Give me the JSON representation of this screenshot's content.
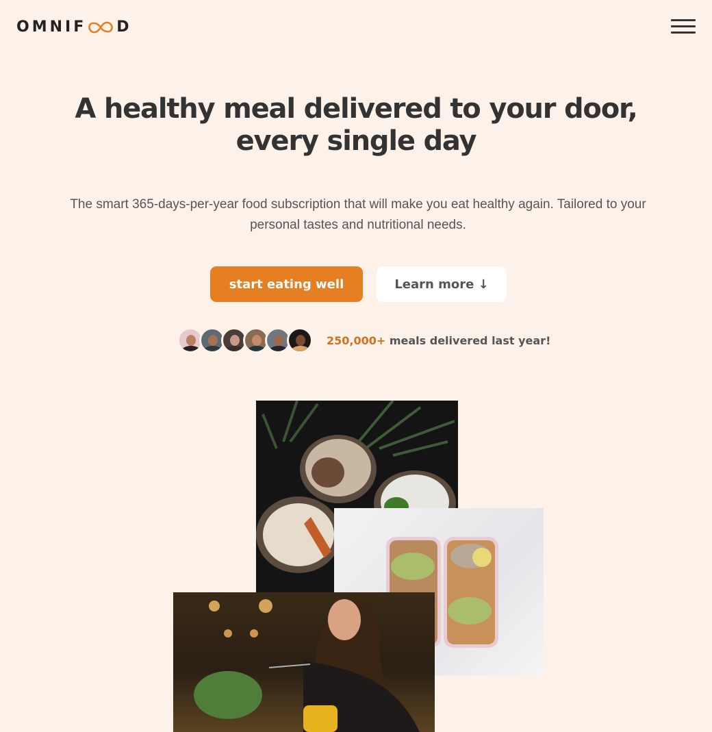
{
  "header": {
    "logo_text_before": "OMNIF",
    "logo_text_after": "D",
    "logo_infinity_icon": "infinity-icon",
    "accent_color": "#e67e22",
    "menu_icon": "hamburger-menu-icon"
  },
  "hero": {
    "title_line1": "A healthy meal delivered to your door,",
    "title_line2": "every single day",
    "description": "The smart 365-days-per-year food subscription that will make you eat healthy again. Tailored to your personal tastes and nutritional needs.",
    "primary_button": "start eating well",
    "secondary_button": "Learn more ↓",
    "delivered_count": "250,000+",
    "delivered_text": " meals delivered last year!",
    "customers": [
      {
        "label": "customer-1"
      },
      {
        "label": "customer-2"
      },
      {
        "label": "customer-3"
      },
      {
        "label": "customer-4"
      },
      {
        "label": "customer-5"
      },
      {
        "label": "customer-6"
      }
    ]
  },
  "gallery": {
    "images": [
      {
        "name": "bowls-of-food-photo"
      },
      {
        "name": "meal-prep-boxes-photo"
      },
      {
        "name": "woman-enjoying-food-photo"
      }
    ]
  }
}
